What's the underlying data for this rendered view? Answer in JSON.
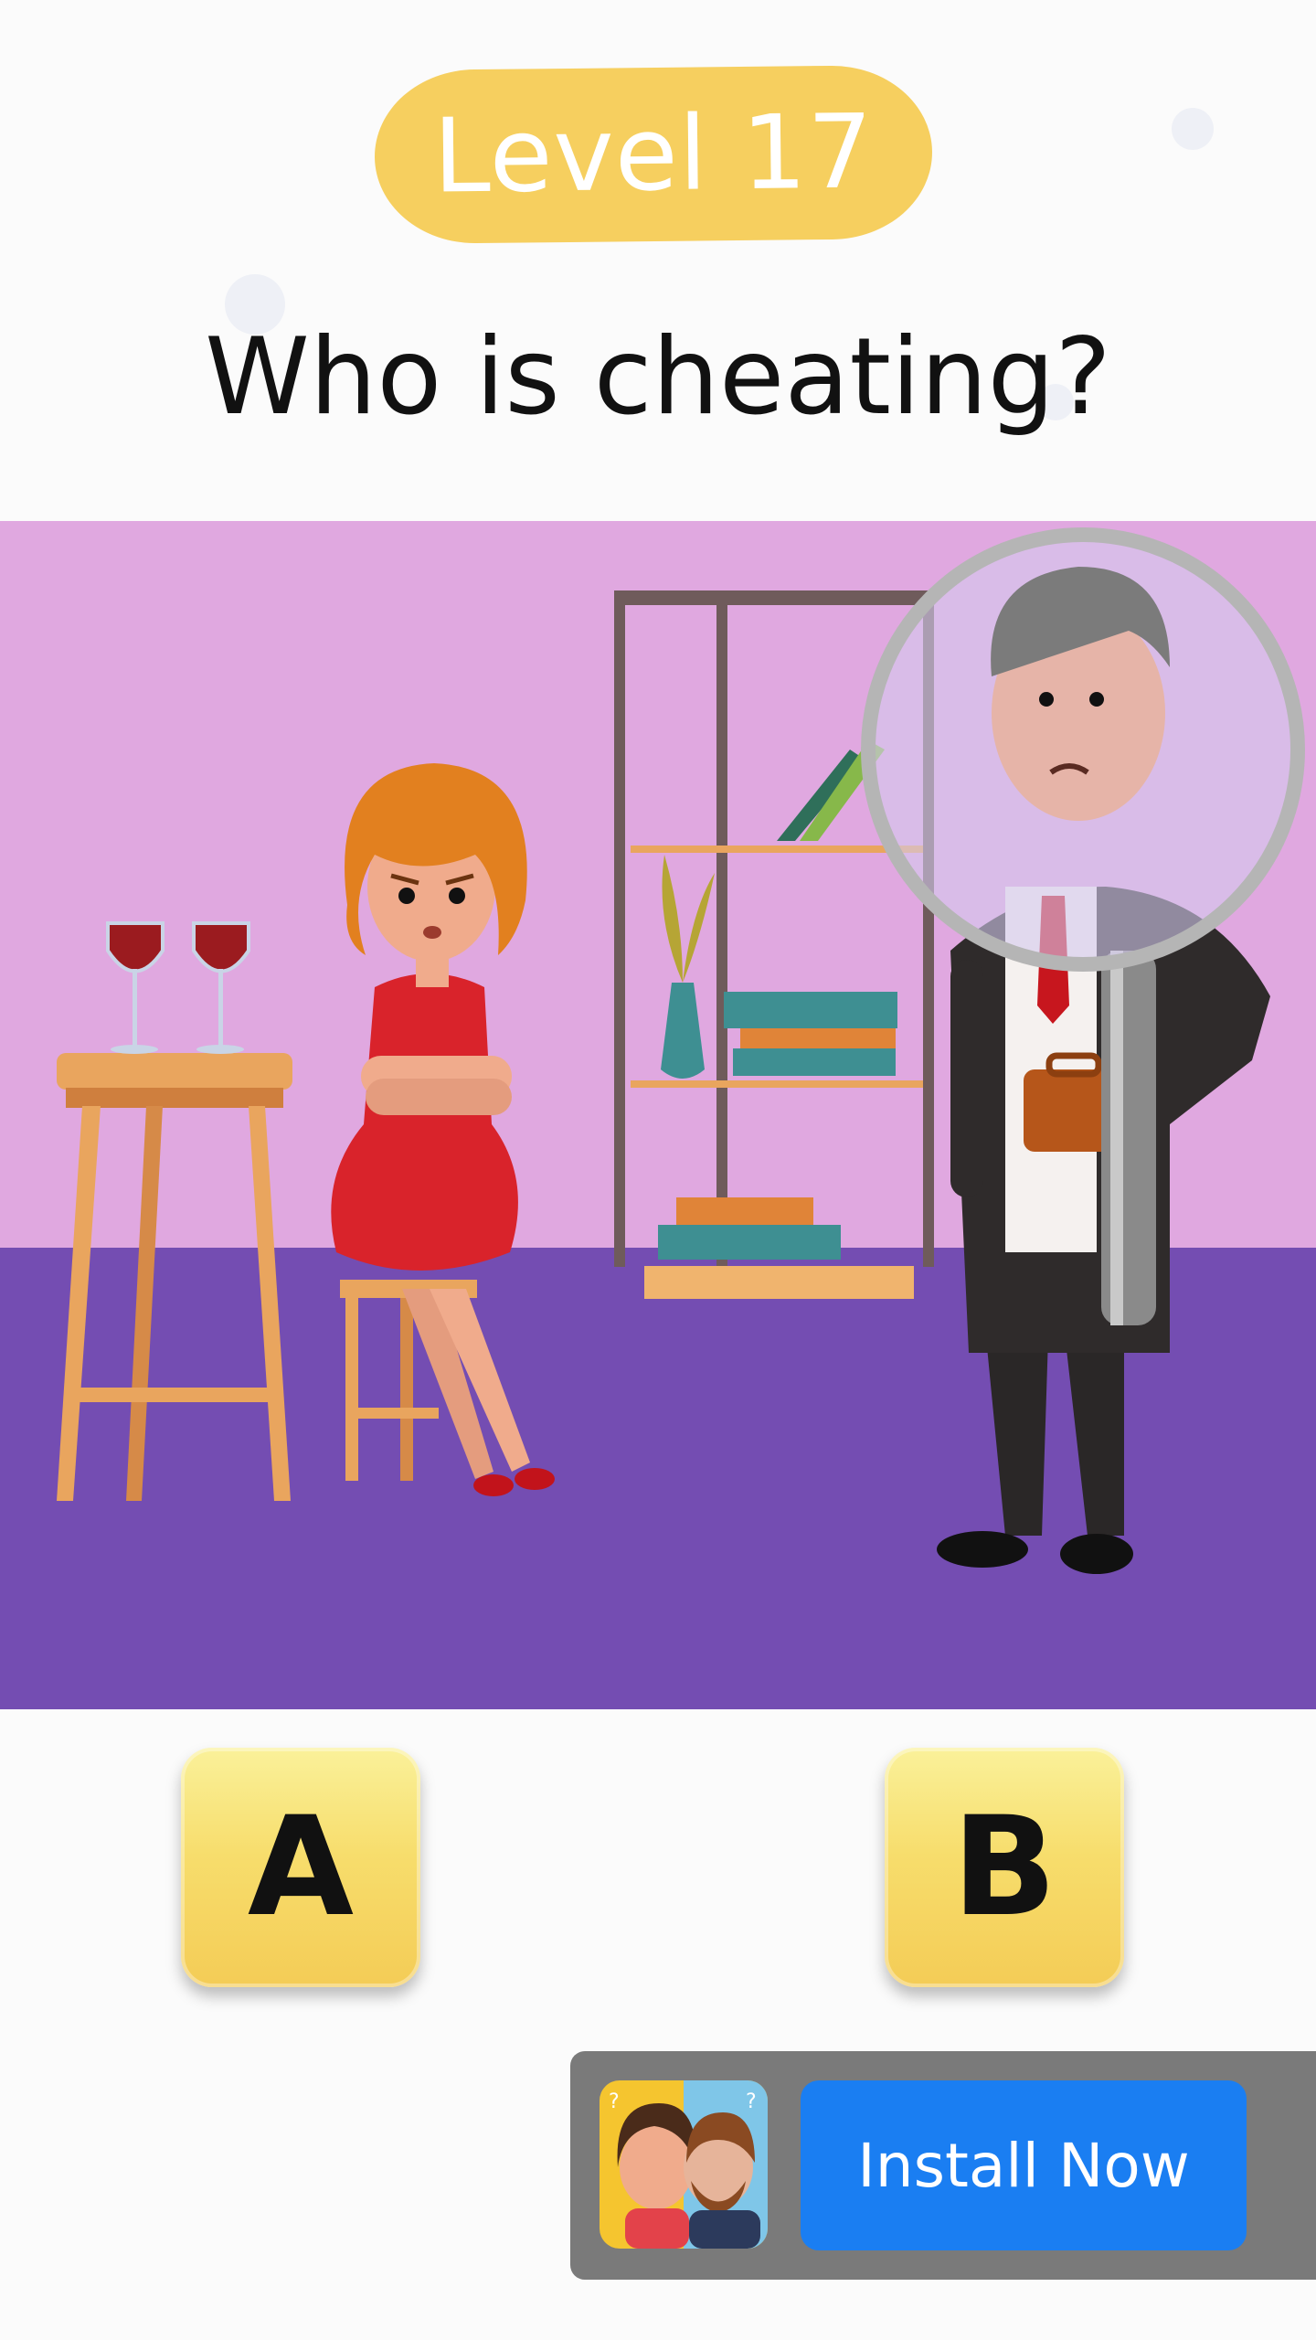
{
  "header": {
    "level_label": "Level 17",
    "question": "Who is cheating?"
  },
  "answers": [
    {
      "label": "A"
    },
    {
      "label": "B"
    }
  ],
  "ad": {
    "cta_label": "Install Now",
    "icon_name": "couple-app-icon"
  },
  "colors": {
    "level_pill": "#f6cf5f",
    "wall": "#e0a8e0",
    "floor": "#744db2",
    "install_button": "#1a7ef2",
    "ad_background": "#7a7a7a"
  }
}
